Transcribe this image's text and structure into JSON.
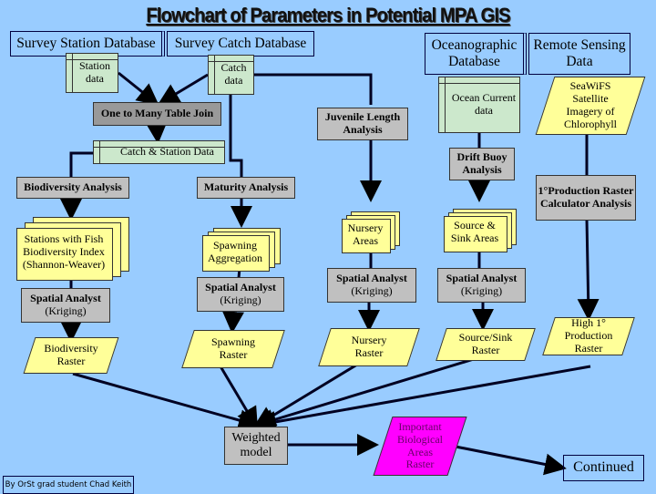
{
  "title": "Flowchart of Parameters in Potential MPA GIS",
  "credit": "By OrSt grad student Chad Keith",
  "colors": {
    "background": "#99ccff",
    "data_store": "#cce8cc",
    "process": "#c0c0c0",
    "output": "#ffff99",
    "final_output": "#ff00ff"
  },
  "databases": {
    "survey_station": "Survey Station Database",
    "survey_catch": "Survey Catch Database",
    "oceanographic": "Oceanographic Database",
    "remote_sensing": "Remote Sensing Data"
  },
  "data_stores": {
    "station_data": "Station data",
    "catch_data": "Catch data",
    "catch_station_data": "Catch & Station Data",
    "ocean_current_data": "Ocean Current data"
  },
  "processes": {
    "table_join": "One to Many Table Join",
    "juvenile_length": "Juvenile Length Analysis",
    "drift_buoy": "Drift Buoy Analysis",
    "biodiversity_analysis": "Biodiversity Analysis",
    "maturity_analysis": "Maturity Analysis",
    "primary_production": "1°Production Raster Calculator Analysis",
    "spatial_analyst": "Spatial Analyst",
    "kriging": "(Kriging)",
    "weighted_model": "Weighted model"
  },
  "documents": {
    "biodiversity_index": "Stations with Fish Biodiversity Index (Shannon-Weaver)",
    "spawning_aggregation": "Spawning Aggregation",
    "nursery_areas": "Nursery Areas",
    "source_sink_areas": "Source & Sink Areas"
  },
  "outputs": {
    "seawifs": "SeaWiFS Satellite Imagery of Chlorophyll",
    "biodiversity_raster": "Biodiversity Raster",
    "spawning_raster": "Spawning Raster",
    "nursery_raster": "Nursery Raster",
    "source_sink_raster": "Source/Sink Raster",
    "high_production_raster": "High 1° Production Raster",
    "important_areas_raster": "Important Biological Areas Raster"
  },
  "continued": "Continued"
}
